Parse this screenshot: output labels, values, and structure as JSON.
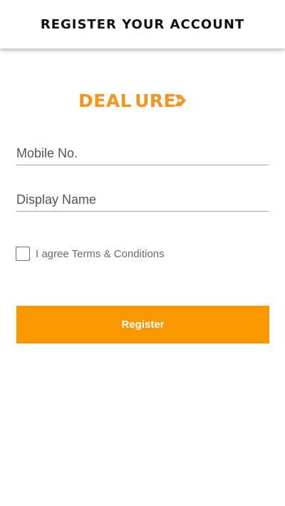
{
  "header": {
    "title": "REGISTER YOUR ACCOUNT"
  },
  "logo": {
    "text_part1": "DEAL",
    "text_part2": "URE"
  },
  "form": {
    "mobile": {
      "placeholder": "Mobile No.",
      "value": ""
    },
    "display_name": {
      "placeholder": "Display Name",
      "value": ""
    },
    "agree_label": "I agree Terms & Conditions",
    "agree_checked": false,
    "submit_label": "Register"
  },
  "colors": {
    "accent": "#fb9800",
    "logo": "#f7941d",
    "underline": "#a8a8a8"
  }
}
